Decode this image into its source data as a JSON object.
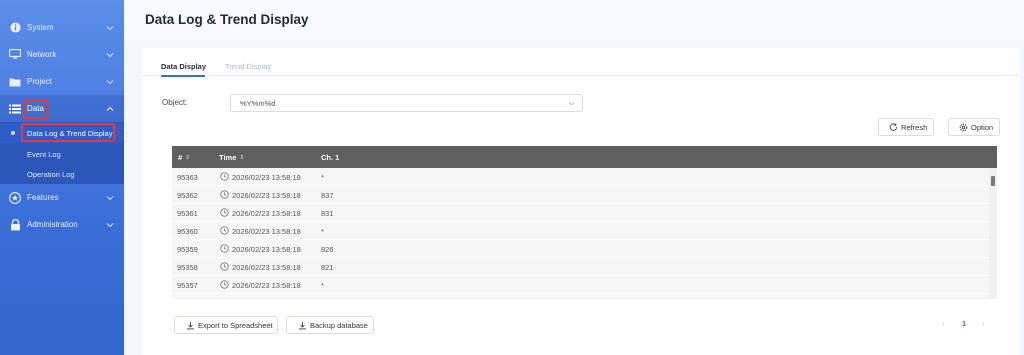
{
  "sidebar": {
    "items": [
      {
        "label": "System",
        "icon": "info-icon"
      },
      {
        "label": "Network",
        "icon": "monitor-icon"
      },
      {
        "label": "Project",
        "icon": "folder-icon"
      },
      {
        "label": "Data",
        "icon": "list-icon"
      },
      {
        "label": "Features",
        "icon": "star-icon"
      },
      {
        "label": "Administration",
        "icon": "lock-icon"
      }
    ],
    "sub_items": [
      {
        "label": "Data Log & Trend Display"
      },
      {
        "label": "Event Log"
      },
      {
        "label": "Operation Log"
      }
    ]
  },
  "header": {
    "title": "Data Log & Trend Display"
  },
  "tabs": [
    {
      "label": "Data Display"
    },
    {
      "label": "Trend Display"
    }
  ],
  "object": {
    "label": "Object:",
    "value": "%Y%m%d"
  },
  "toolbar": {
    "refresh_label": "Refresh",
    "option_label": "Option"
  },
  "table": {
    "columns": [
      "#",
      "Time",
      "Ch. 1"
    ],
    "rows": [
      {
        "id": "95363",
        "time": "2026/02/23 13:58:19",
        "ch1": "*"
      },
      {
        "id": "95362",
        "time": "2026/02/23 13:58:18",
        "ch1": "837"
      },
      {
        "id": "95361",
        "time": "2026/02/23 13:58:18",
        "ch1": "831"
      },
      {
        "id": "95360",
        "time": "2026/02/23 13:58:18",
        "ch1": "*"
      },
      {
        "id": "95359",
        "time": "2026/02/23 13:58:18",
        "ch1": "826"
      },
      {
        "id": "95358",
        "time": "2026/02/23 13:58:18",
        "ch1": "821"
      },
      {
        "id": "95357",
        "time": "2026/02/23 13:58:18",
        "ch1": "*"
      }
    ]
  },
  "footer": {
    "export_label": "Export to Spreadsheet",
    "backup_label": "Backup database"
  },
  "pagination": {
    "prev": "‹",
    "current": "1",
    "next": "›"
  },
  "colors": {
    "sidebar": "#3b6fd8",
    "accent": "#3b6fd8",
    "highlight": "#e53935",
    "table_header": "#5f5f5f"
  }
}
